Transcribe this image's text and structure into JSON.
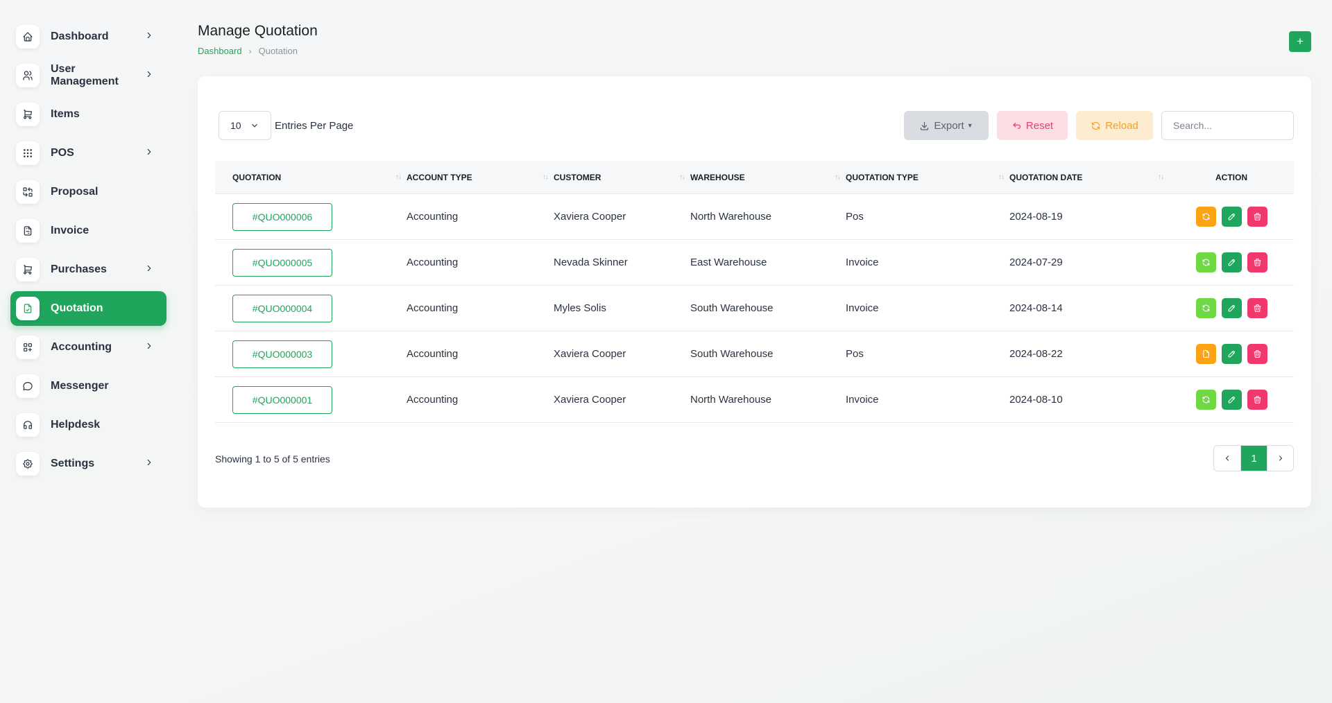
{
  "sidebar": {
    "items": [
      {
        "label": "Dashboard",
        "icon": "home-icon",
        "chevron": true,
        "active": false
      },
      {
        "label": "User Management",
        "icon": "users-icon",
        "chevron": true,
        "active": false
      },
      {
        "label": "Items",
        "icon": "cart-icon",
        "chevron": false,
        "active": false
      },
      {
        "label": "POS",
        "icon": "grid-dots-icon",
        "chevron": true,
        "active": false
      },
      {
        "label": "Proposal",
        "icon": "replace-icon",
        "chevron": false,
        "active": false
      },
      {
        "label": "Invoice",
        "icon": "file-invoice-icon",
        "chevron": false,
        "active": false
      },
      {
        "label": "Purchases",
        "icon": "shopping-cart-icon",
        "chevron": true,
        "active": false
      },
      {
        "label": "Quotation",
        "icon": "file-report-icon",
        "chevron": false,
        "active": true
      },
      {
        "label": "Accounting",
        "icon": "layout-plus-icon",
        "chevron": true,
        "active": false
      },
      {
        "label": "Messenger",
        "icon": "message-icon",
        "chevron": false,
        "active": false
      },
      {
        "label": "Helpdesk",
        "icon": "headphones-icon",
        "chevron": false,
        "active": false
      },
      {
        "label": "Settings",
        "icon": "gear-icon",
        "chevron": true,
        "active": false
      }
    ]
  },
  "header": {
    "title": "Manage Quotation",
    "breadcrumb": {
      "home": "Dashboard",
      "current": "Quotation"
    },
    "add_label": "+"
  },
  "toolbar": {
    "per_page_value": "10",
    "per_page_label": "Entries Per Page",
    "export_label": "Export",
    "reset_label": "Reset",
    "reload_label": "Reload",
    "search_placeholder": "Search..."
  },
  "table": {
    "columns": [
      "QUOTATION",
      "ACCOUNT TYPE",
      "CUSTOMER",
      "WAREHOUSE",
      "QUOTATION TYPE",
      "QUOTATION DATE",
      "ACTION"
    ],
    "rows": [
      {
        "quotation": "#QUO000006",
        "account_type": "Accounting",
        "customer": "Xaviera Cooper",
        "warehouse": "North Warehouse",
        "quotation_type": "Pos",
        "date": "2024-08-19",
        "convert_icon": "refresh-icon",
        "convert_color": "#fca314"
      },
      {
        "quotation": "#QUO000005",
        "account_type": "Accounting",
        "customer": "Nevada Skinner",
        "warehouse": "East Warehouse",
        "quotation_type": "Invoice",
        "date": "2024-07-29",
        "convert_icon": "refresh-icon",
        "convert_color": "#6fd943"
      },
      {
        "quotation": "#QUO000004",
        "account_type": "Accounting",
        "customer": "Myles Solis",
        "warehouse": "South Warehouse",
        "quotation_type": "Invoice",
        "date": "2024-08-14",
        "convert_icon": "refresh-icon",
        "convert_color": "#6fd943"
      },
      {
        "quotation": "#QUO000003",
        "account_type": "Accounting",
        "customer": "Xaviera Cooper",
        "warehouse": "South Warehouse",
        "quotation_type": "Pos",
        "date": "2024-08-22",
        "convert_icon": "file-icon",
        "convert_color": "#fca314"
      },
      {
        "quotation": "#QUO000001",
        "account_type": "Accounting",
        "customer": "Xaviera Cooper",
        "warehouse": "North Warehouse",
        "quotation_type": "Invoice",
        "date": "2024-08-10",
        "convert_icon": "refresh-icon",
        "convert_color": "#6fd943"
      }
    ]
  },
  "footer": {
    "showing_text": "Showing 1 to 5 of 5 entries",
    "current_page": "1"
  },
  "colors": {
    "brand": "#1fa55c",
    "warning": "#fca314",
    "success": "#6fd943",
    "danger": "#f0386c"
  }
}
